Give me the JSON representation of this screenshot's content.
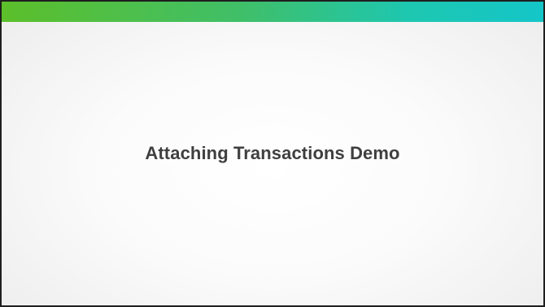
{
  "slide": {
    "title": "Attaching Transactions Demo",
    "accent_colors": [
      "#5cbf2a",
      "#14c6c8"
    ],
    "title_color": "#3f3f3f"
  }
}
